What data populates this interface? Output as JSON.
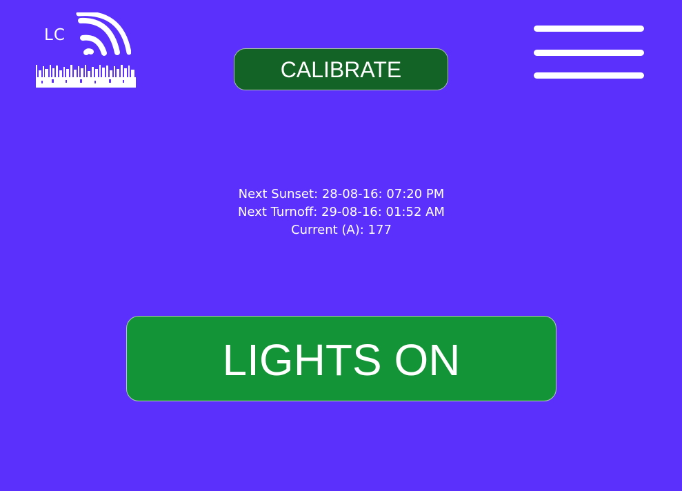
{
  "header": {
    "logo_text": "LC",
    "logo_icon": "wifi-waves-and-grass-icon",
    "menu_icon": "hamburger-menu-icon"
  },
  "calibrate": {
    "label": "CALIBRATE"
  },
  "status": {
    "next_sunset": "Next Sunset: 28-08-16: 07:20 PM",
    "next_turnoff": "Next Turnoff: 29-08-16: 01:52 AM",
    "current": "Current (A): 177"
  },
  "lights": {
    "label": "LIGHTS ON"
  },
  "colors": {
    "background": "#5b30fc",
    "calibrate_fill": "#146326",
    "lights_fill": "#139537",
    "text": "#ffffff"
  }
}
